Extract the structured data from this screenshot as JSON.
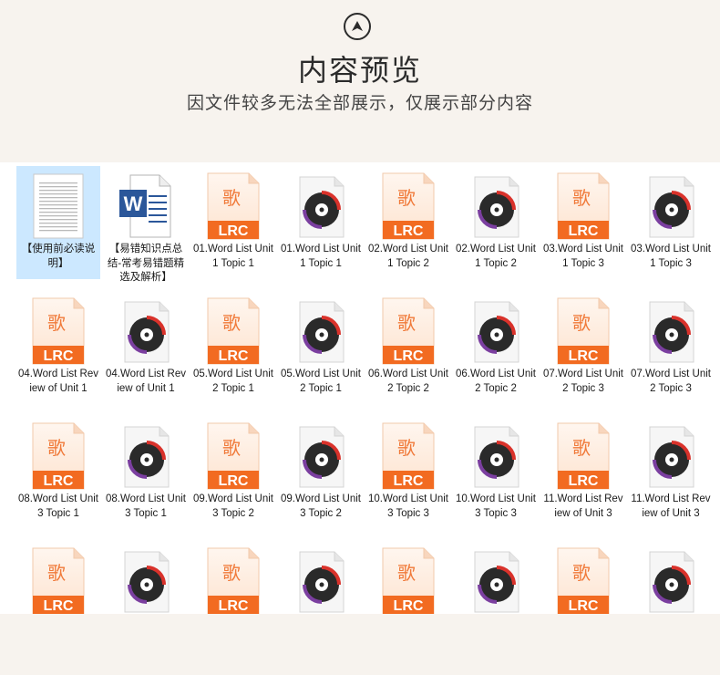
{
  "header": {
    "title": "内容预览",
    "subtitle": "因文件较多无法全部展示，仅展示部分内容"
  },
  "icons": {
    "txt": "text-file-icon",
    "doc": "word-document-icon",
    "lrc": "lrc-lyrics-file-icon",
    "mp3": "audio-file-icon"
  },
  "colors": {
    "lrc_orange": "#f26b21",
    "audio_purple": "#7b3fa0",
    "selected": "#cce8ff"
  },
  "files": [
    {
      "type": "txt",
      "label": "【使用前必读说明】",
      "selected": true
    },
    {
      "type": "doc",
      "label": "【易错知识点总结-常考易错题精选及解析】"
    },
    {
      "type": "lrc",
      "label": "01.Word List Unit 1 Topic 1"
    },
    {
      "type": "mp3",
      "label": "01.Word List Unit 1 Topic 1"
    },
    {
      "type": "lrc",
      "label": "02.Word List Unit 1 Topic 2"
    },
    {
      "type": "mp3",
      "label": "02.Word List Unit 1 Topic 2"
    },
    {
      "type": "lrc",
      "label": "03.Word List Unit 1 Topic 3"
    },
    {
      "type": "mp3",
      "label": "03.Word List Unit 1 Topic 3"
    },
    {
      "type": "lrc",
      "label": "04.Word List Review of Unit 1"
    },
    {
      "type": "mp3",
      "label": "04.Word List Review of Unit 1"
    },
    {
      "type": "lrc",
      "label": "05.Word List Unit 2 Topic 1"
    },
    {
      "type": "mp3",
      "label": "05.Word List Unit 2 Topic 1"
    },
    {
      "type": "lrc",
      "label": "06.Word List Unit 2 Topic 2"
    },
    {
      "type": "mp3",
      "label": "06.Word List Unit 2 Topic 2"
    },
    {
      "type": "lrc",
      "label": "07.Word List Unit 2 Topic 3"
    },
    {
      "type": "mp3",
      "label": "07.Word List Unit 2 Topic 3"
    },
    {
      "type": "lrc",
      "label": "08.Word List Unit 3 Topic 1"
    },
    {
      "type": "mp3",
      "label": "08.Word List Unit 3 Topic 1"
    },
    {
      "type": "lrc",
      "label": "09.Word List Unit 3 Topic 2"
    },
    {
      "type": "mp3",
      "label": "09.Word List Unit 3 Topic 2"
    },
    {
      "type": "lrc",
      "label": "10.Word List Unit 3 Topic 3"
    },
    {
      "type": "mp3",
      "label": "10.Word List Unit 3 Topic 3"
    },
    {
      "type": "lrc",
      "label": "11.Word List Review of Unit 3"
    },
    {
      "type": "mp3",
      "label": "11.Word List Review of Unit 3"
    },
    {
      "type": "lrc",
      "label": ""
    },
    {
      "type": "mp3",
      "label": ""
    },
    {
      "type": "lrc",
      "label": ""
    },
    {
      "type": "mp3",
      "label": ""
    },
    {
      "type": "lrc",
      "label": ""
    },
    {
      "type": "mp3",
      "label": ""
    },
    {
      "type": "lrc",
      "label": ""
    },
    {
      "type": "mp3",
      "label": ""
    }
  ],
  "glyphs": {
    "lrc_char": "歌",
    "lrc_text": "LRC",
    "word_letter": "W"
  }
}
